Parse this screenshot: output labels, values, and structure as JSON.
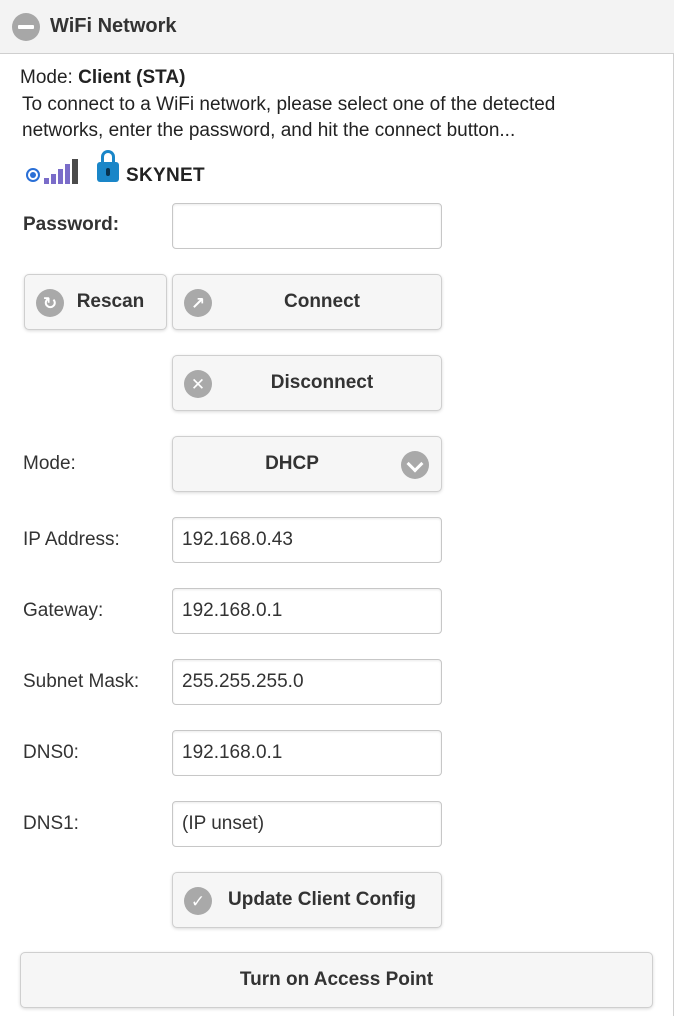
{
  "header": {
    "title": "WiFi Network"
  },
  "mode": {
    "label": "Mode:",
    "value": "Client (STA)"
  },
  "instructions": "To connect to a WiFi network, please select one of the detected networks, enter the password, and hit the connect button...",
  "network": {
    "ssid": "SKYNET",
    "selected": true,
    "signal_bars": 5,
    "secured": true
  },
  "password": {
    "label": "Password:",
    "value": "",
    "placeholder": ""
  },
  "buttons": {
    "rescan": "Rescan",
    "connect": "Connect",
    "disconnect": "Disconnect",
    "update": "Update Client Config",
    "access_point": "Turn on Access Point"
  },
  "ip_mode": {
    "label": "Mode:",
    "value": "DHCP"
  },
  "fields": {
    "ip": {
      "label": "IP Address:",
      "value": "192.168.0.43"
    },
    "gateway": {
      "label": "Gateway:",
      "value": "192.168.0.1"
    },
    "subnet": {
      "label": "Subnet Mask:",
      "value": "255.255.255.0"
    },
    "dns0": {
      "label": "DNS0:",
      "value": "192.168.0.1"
    },
    "dns1": {
      "label": "DNS1:",
      "value": "(IP unset)"
    }
  },
  "colors": {
    "accent": "#2a6fd6",
    "lock": "#1a86c8",
    "signal": "#7a6cc9",
    "button_bg": "#f6f6f6"
  }
}
